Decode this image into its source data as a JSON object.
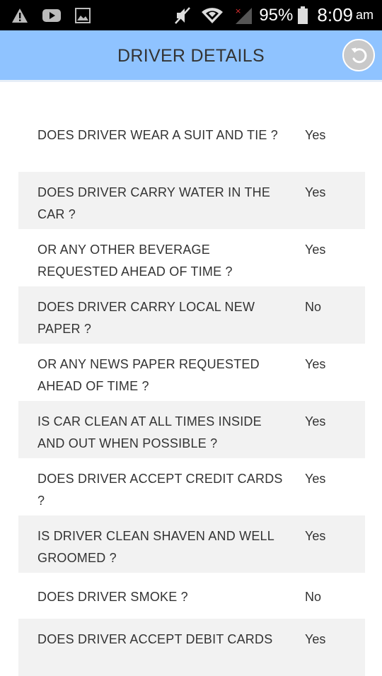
{
  "status_bar": {
    "left_icons": [
      "warning-icon",
      "youtube-icon",
      "image-icon"
    ],
    "right_icons": [
      "mute-icon",
      "wifi-icon",
      "signal-icon",
      "battery-icon"
    ],
    "battery_percent": "95%",
    "time": "8:09",
    "ampm": "am"
  },
  "header": {
    "title": "DRIVER DETAILS",
    "background_color": "#8fc3ff",
    "back_icon": "undo-icon"
  },
  "details": [
    {
      "question": "DOES DRIVER WEAR A SUIT AND TIE ?",
      "answer": "Yes"
    },
    {
      "question": "DOES DRIVER CARRY WATER IN THE CAR ?",
      "answer": "Yes"
    },
    {
      "question": "OR ANY OTHER BEVERAGE REQUESTED AHEAD OF TIME ?",
      "answer": "Yes"
    },
    {
      "question": "DOES DRIVER CARRY LOCAL NEW PAPER ?",
      "answer": "No"
    },
    {
      "question": "OR ANY NEWS PAPER REQUESTED AHEAD OF TIME ?",
      "answer": "Yes"
    },
    {
      "question": "IS CAR CLEAN AT ALL TIMES INSIDE AND OUT WHEN POSSIBLE ?",
      "answer": "Yes"
    },
    {
      "question": "DOES DRIVER ACCEPT CREDIT CARDS ?",
      "answer": "Yes"
    },
    {
      "question": "IS DRIVER CLEAN SHAVEN AND WELL GROOMED ?",
      "answer": "Yes"
    },
    {
      "question": "DOES DRIVER SMOKE ?",
      "answer": "No"
    },
    {
      "question": "DOES DRIVER ACCEPT DEBIT CARDS",
      "answer": "Yes"
    }
  ]
}
